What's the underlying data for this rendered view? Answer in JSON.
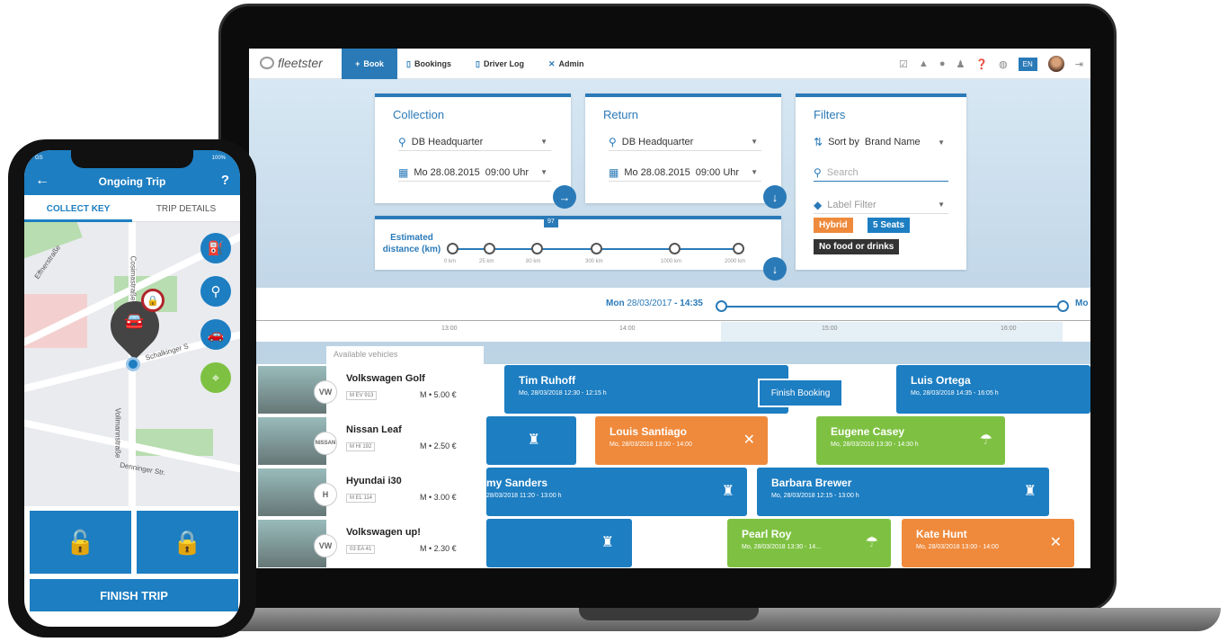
{
  "app": {
    "logo_text": "fleetster",
    "lang": "EN"
  },
  "nav": [
    {
      "label": "Book",
      "icon": "plus-icon"
    },
    {
      "label": "Bookings",
      "icon": "document-icon"
    },
    {
      "label": "Driver Log",
      "icon": "document-icon"
    },
    {
      "label": "Admin",
      "icon": "tools-icon"
    }
  ],
  "collection": {
    "title": "Collection",
    "location": "DB Headquarter",
    "date": "Mo 28.08.2015",
    "time": "09:00 Uhr"
  },
  "return": {
    "title": "Return",
    "location": "DB Headquarter",
    "date": "Mo 28.08.2015",
    "time": "09:00 Uhr"
  },
  "filters": {
    "title": "Filters",
    "sort_prefix": "Sort by",
    "sort_value": "Brand Name",
    "search_placeholder": "Search",
    "label_placeholder": "Label Filter",
    "tags": [
      "Hybrid",
      "5 Seats",
      "No food or drinks"
    ]
  },
  "distance": {
    "label": "Estimated distance (km)",
    "selected": "97",
    "ticks": [
      "0 km",
      "25 km",
      "80 km",
      "300 km",
      "1000 km",
      "2000 km"
    ]
  },
  "timeline": {
    "weekday": "Mon",
    "date": "28/03/2017",
    "time": "14:35",
    "end_weekday": "Mo",
    "hours": [
      "13:00",
      "14:00",
      "15:00",
      "16:00"
    ]
  },
  "available_label": "Available vehicles",
  "vehicles": [
    {
      "name": "Volkswagen Golf",
      "plate": "M EV 913",
      "price": "M • 5.00 €",
      "brand": "VW"
    },
    {
      "name": "Nissan Leaf",
      "plate": "M HI 192",
      "price": "M • 2.50 €",
      "brand": "NISSAN"
    },
    {
      "name": "Hyundai i30",
      "plate": "M EL 114",
      "price": "M • 3.00 €",
      "brand": "H"
    },
    {
      "name": "Volkswagen up!",
      "plate": "03 EA 41",
      "price": "M • 2.30 €",
      "brand": "VW"
    }
  ],
  "bookings": [
    {
      "name": "Tim Ruhoff",
      "date": "Mo, 28/03/2018 12:30 - 12:15 h"
    },
    {
      "name": "Luis Ortega",
      "date": "Mo, 28/03/2018 14:35 - 16:05 h"
    },
    {
      "name": "Louis Santiago",
      "date": "Mo, 28/03/2018 13:00 - 14:00"
    },
    {
      "name": "Eugene Casey",
      "date": "Mo, 28/03/2018 13:30 - 14:30 h"
    },
    {
      "name": "my Sanders",
      "date": "28/03/2018 11:20 - 13:00 h"
    },
    {
      "name": "Barbara Brewer",
      "date": "Mo, 28/03/2018 12:15 - 13:00 h"
    },
    {
      "name": "Pearl Roy",
      "date": "Mo, 28/03/2018 13:30 - 14..."
    },
    {
      "name": "Kate Hunt",
      "date": "Mo, 28/03/2018 13:00 - 14:00"
    }
  ],
  "finish_booking": "Finish Booking",
  "phone": {
    "carrier": "GS",
    "battery": "100%",
    "title": "Ongoing Trip",
    "help": "?",
    "tabs": [
      "COLLECT KEY",
      "TRIP DETAILS"
    ],
    "streets": [
      "Effnerstraße",
      "Cosimastraße",
      "Schalkinger S",
      "Vollmannstraße",
      "Denninger Str."
    ],
    "finish_label": "FINISH TRIP"
  },
  "colors": {
    "primary": "#1d7ec2",
    "orange": "#ef8a3c",
    "green": "#7ec142",
    "lock_ring": "#b0252a"
  }
}
